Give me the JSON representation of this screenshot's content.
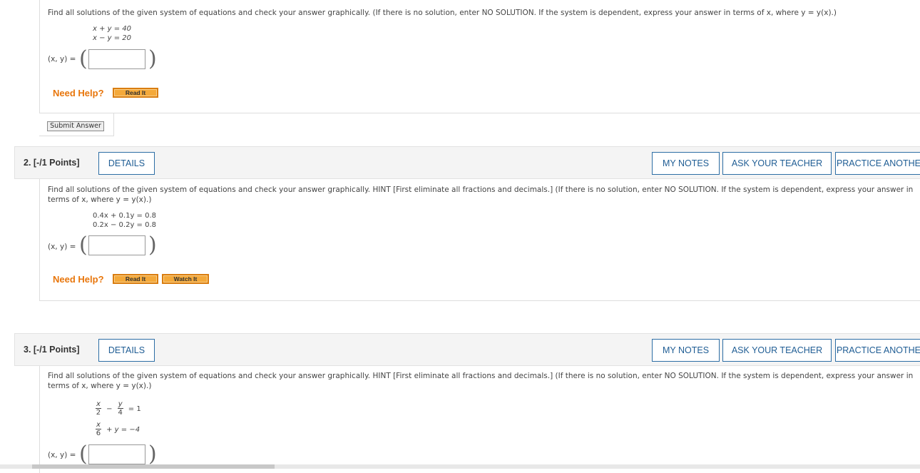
{
  "q1": {
    "text": "Find all solutions of the given system of equations and check your answer graphically. (If there is no solution, enter NO SOLUTION. If the system is dependent, express your answer in terms of x, where y = y(x).)",
    "eq1": "x + y = 40",
    "eq2": "x − y = 20",
    "answer_label": "(x, y) =",
    "answer_value": "",
    "need_help": "Need Help?",
    "read_it": "Read It",
    "submit": "Submit Answer"
  },
  "q2": {
    "number": "2.  [-/1 Points]",
    "details": "DETAILS",
    "my_notes": "MY NOTES",
    "ask_teacher": "ASK YOUR TEACHER",
    "practice": "PRACTICE ANOTHER",
    "text_line1": "Find all solutions of the given system of equations and check your answer graphically. HINT [First eliminate all fractions and decimals.] (If there is no solution, enter NO SOLUTION. If the system is dependent, express your answer in",
    "text_line2": "terms of x, where y = y(x).)",
    "eq1": "0.4x + 0.1y = 0.8",
    "eq2": "0.2x − 0.2y = 0.8",
    "answer_label": "(x, y) =",
    "answer_value": "",
    "need_help": "Need Help?",
    "read_it": "Read It",
    "watch_it": "Watch It"
  },
  "q3": {
    "number": "3.  [-/1 Points]",
    "details": "DETAILS",
    "my_notes": "MY NOTES",
    "ask_teacher": "ASK YOUR TEACHER",
    "practice": "PRACTICE ANOTHER",
    "text_line1": "Find all solutions of the given system of equations and check your answer graphically. HINT [First eliminate all fractions and decimals.] (If there is no solution, enter NO SOLUTION. If the system is dependent, express your answer in",
    "text_line2": "terms of x, where y = y(x).)",
    "eq1_num_a": "x",
    "eq1_den_a": "2",
    "eq1_op": "−",
    "eq1_num_b": "y",
    "eq1_den_b": "4",
    "eq1_rhs": "= 1",
    "eq2_num_a": "x",
    "eq2_den_a": "6",
    "eq2_rest": "+  y = −4",
    "answer_label": "(x, y) =",
    "answer_value": ""
  },
  "colors": {
    "accent_blue": "#1f5d94",
    "help_orange": "#e8760c",
    "button_orange": "#f4a93a"
  }
}
